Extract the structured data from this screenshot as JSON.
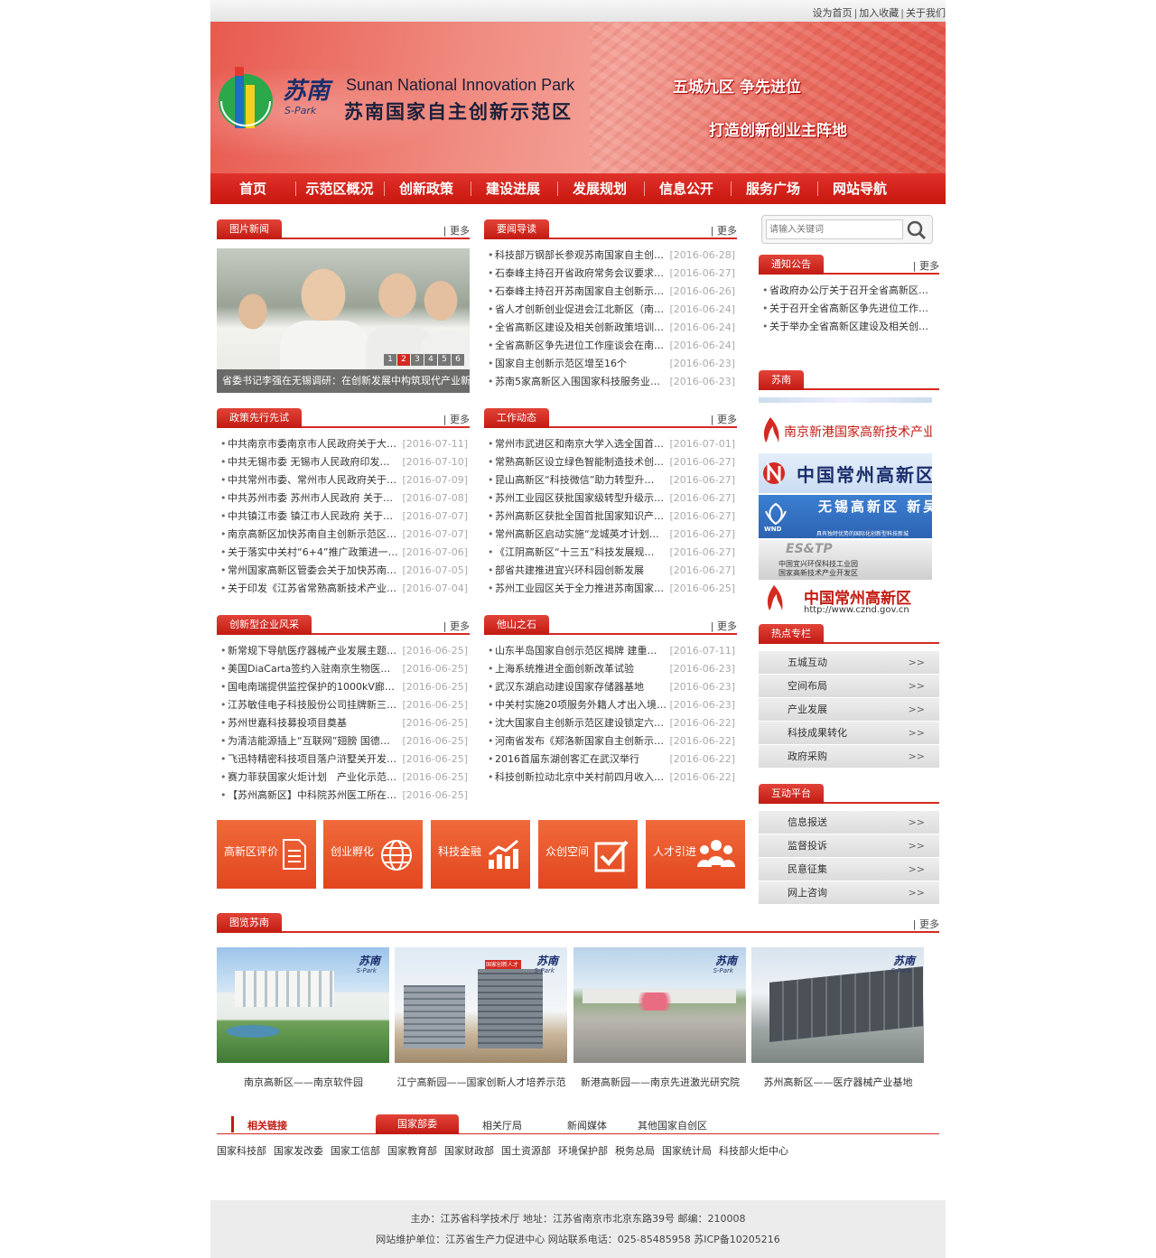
{
  "top_links": [
    "设为首页",
    "加入收藏",
    "关于我们"
  ],
  "banner": {
    "logo_cn": "苏南",
    "logo_sub": "S-Park",
    "park_en": "Sunan National Innovation Park",
    "park_cn": "苏南国家自主创新示范区",
    "slogan1": "五城九区  争先进位",
    "slogan2": "打造创新创业主阵地"
  },
  "nav": [
    "首页",
    "示范区概况",
    "创新政策",
    "建设进展",
    "发展规划",
    "信息公开",
    "服务广场",
    "网站导航"
  ],
  "more_label": "更多",
  "photo_news": {
    "title": "图片新闻",
    "caption": "省委书记李强在无锡调研：在创新发展中构筑现代产业新高",
    "pages": [
      "1",
      "2",
      "3",
      "4",
      "5",
      "6"
    ],
    "active_page": 2
  },
  "news_guide": {
    "title": "要闻导读",
    "items": [
      {
        "t": "科技部万钢部长参观苏南国家自主创…",
        "d": "[2016-06-28]"
      },
      {
        "t": "石泰峰主持召开省政府常务会议要求…",
        "d": "[2016-06-27]"
      },
      {
        "t": "石泰峰主持召开苏南国家自主创新示…",
        "d": "[2016-06-26]"
      },
      {
        "t": "省人才创新创业促进会江北新区（南…",
        "d": "[2016-06-24]"
      },
      {
        "t": "全省高新区建设及相关创新政策培训…",
        "d": "[2016-06-24]"
      },
      {
        "t": "全省高新区争先进位工作座谈会在南…",
        "d": "[2016-06-24]"
      },
      {
        "t": "国家自主创新示范区增至16个",
        "d": "[2016-06-23]"
      },
      {
        "t": "苏南5家高新区入围国家科技服务业区…",
        "d": "[2016-06-23]"
      }
    ]
  },
  "policy": {
    "title": "政策先行先试",
    "items": [
      {
        "t": "中共南京市委南京市人民政府关于大…",
        "d": "[2016-07-11]"
      },
      {
        "t": "中共无锡市委 无锡市人民政府印发《…",
        "d": "[2016-07-10]"
      },
      {
        "t": "中共常州市委、常州市人民政府关于…",
        "d": "[2016-07-09]"
      },
      {
        "t": "中共苏州市委 苏州市人民政府 关于…",
        "d": "[2016-07-08]"
      },
      {
        "t": "中共镇江市委 镇江市人民政府 关于…",
        "d": "[2016-07-07]"
      },
      {
        "t": "南京高新区加快苏南自主创新示范区…",
        "d": "[2016-07-07]"
      },
      {
        "t": "关于落实中关村“6+4”推广政策进一…",
        "d": "[2016-07-06]"
      },
      {
        "t": "常州国家高新区管委会关于加快苏南…",
        "d": "[2016-07-05]"
      },
      {
        "t": "关于印发《江苏省常熟高新技术产业…",
        "d": "[2016-07-04]"
      }
    ]
  },
  "work": {
    "title": "工作动态",
    "items": [
      {
        "t": "常州市武进区和南京大学入选全国首…",
        "d": "[2016-07-01]"
      },
      {
        "t": "常熟高新区设立绿色智能制造技术创…",
        "d": "[2016-06-27]"
      },
      {
        "t": "昆山高新区“科技微信”助力转型升…",
        "d": "[2016-06-27]"
      },
      {
        "t": "苏州工业园区获批国家级转型升级示…",
        "d": "[2016-06-27]"
      },
      {
        "t": "苏州高新区获批全国首批国家知识产…",
        "d": "[2016-06-27]"
      },
      {
        "t": "常州高新区启动实施“龙城英才计划…",
        "d": "[2016-06-27]"
      },
      {
        "t": "《江阴高新区“十三五”科技发展规…",
        "d": "[2016-06-27]"
      },
      {
        "t": "部省共建推进宜兴环科园创新发展",
        "d": "[2016-06-27]"
      },
      {
        "t": "苏州工业园区关于全力推进苏南国家…",
        "d": "[2016-06-25]"
      }
    ]
  },
  "enterprise": {
    "title": "创新型企业风采",
    "items": [
      {
        "t": "新常规下导航医疗器械产业发展主题…",
        "d": "[2016-06-25]"
      },
      {
        "t": "美国DiaCarta签约入驻南京生物医药…",
        "d": "[2016-06-25]"
      },
      {
        "t": "国电南瑞提供监控保护的1000kV廊坊…",
        "d": "[2016-06-25]"
      },
      {
        "t": "江苏敏佳电子科技股份公司挂牌新三…",
        "d": "[2016-06-25]"
      },
      {
        "t": "苏州世嘉科技募投项目奠基",
        "d": "[2016-06-25]"
      },
      {
        "t": "为清洁能源插上“互联网”翅膀 国德…",
        "d": "[2016-06-25]"
      },
      {
        "t": "飞迅特精密科技项目落户浒墅关开发…",
        "d": "[2016-06-25]"
      },
      {
        "t": "赛力菲获国家火炬计划　产业化示范…",
        "d": "[2016-06-25]"
      },
      {
        "t": "【苏州高新区】中科院苏州医工所在…",
        "d": "[2016-06-25]"
      }
    ]
  },
  "other": {
    "title": "他山之石",
    "items": [
      {
        "t": "山东半岛国家自创示范区揭牌 建重大…",
        "d": "[2016-07-11]"
      },
      {
        "t": "上海系统推进全面创新改革试验",
        "d": "[2016-06-23]"
      },
      {
        "t": "武汉东湖启动建设国家存储器基地",
        "d": "[2016-06-23]"
      },
      {
        "t": "中关村实施20项服务外籍人才出入境…",
        "d": "[2016-06-23]"
      },
      {
        "t": "沈大国家自主创新示范区建设锁定六…",
        "d": "[2016-06-22]"
      },
      {
        "t": "河南省发布《郑洛新国家自主创新示…",
        "d": "[2016-06-22]"
      },
      {
        "t": "2016首届东湖创客汇在武汉举行",
        "d": "[2016-06-22]"
      },
      {
        "t": "科技创新拉动北京中关村前四月收入…",
        "d": "[2016-06-22]"
      }
    ]
  },
  "search": {
    "placeholder": "请输入关键词"
  },
  "notice": {
    "title": "通知公告",
    "items": [
      "省政府办公厅关于召开全省高新区…",
      "关于召开全省高新区争先进位工作…",
      "关于举办全省高新区建设及相关创…"
    ]
  },
  "sunan": {
    "title": "苏南",
    "logos": [
      "南京新港国家高新技术产业园",
      "中国常州高新区",
      "无锡高新区 新吴区",
      "中国宜兴环保科技工业园",
      "中国常州高新区"
    ],
    "logo_small": [
      "WND",
      "具有独特优势的国际化创新型科技新城",
      "ES&TP",
      "中国宜兴环保科技工业园",
      "国家高新技术产业开发区",
      "http://www.cznd.gov.cn"
    ]
  },
  "hot": {
    "title": "热点专栏",
    "items": [
      "五城互动",
      "空间布局",
      "产业发展",
      "科技成果转化",
      "政府采购"
    ]
  },
  "interact": {
    "title": "互动平台",
    "items": [
      "信息报送",
      "监督投诉",
      "民意征集",
      "网上咨询"
    ]
  },
  "chevron": ">>",
  "quick_links": [
    "高新区评价",
    "创业孵化",
    "科技金融",
    "众创空间",
    "人才引进"
  ],
  "gallery": {
    "title": "图览苏南",
    "items": [
      "南京高新区——南京软件园",
      "江宁高新园——国家创新人才培养示范",
      "新港高新园——南京先进激光研究院",
      "苏州高新区——医疗器械产业基地"
    ],
    "badge": "苏南",
    "badge_sub": "S-Park",
    "sign_text": "国家创新人才"
  },
  "links": {
    "label": "相关链接",
    "tabs": [
      "国家部委",
      "相关厅局",
      "新闻媒体",
      "其他国家自创区"
    ],
    "active_tab": 0,
    "depts": [
      "国家科技部",
      "国家发改委",
      "国家工信部",
      "国家教育部",
      "国家财政部",
      "国土资源部",
      "环境保护部",
      "税务总局",
      "国家统计局",
      "科技部火炬中心"
    ]
  },
  "footer": {
    "line1": "主办：江苏省科学技术厅 地址：江苏省南京市北京东路39号 邮编：210008",
    "line2": "网站维护单位：江苏省生产力促进中心 网站联系电话：025-85485958 苏ICP备10205216"
  },
  "colors": {
    "brand_red": "#d42a22",
    "quick_orange": "#e9542a",
    "banner_pink": "#f08b80"
  }
}
